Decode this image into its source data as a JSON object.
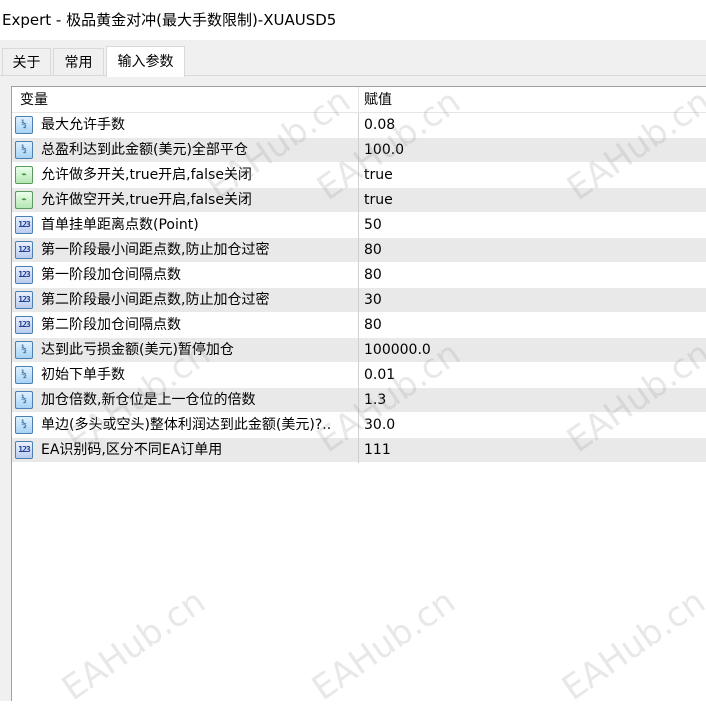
{
  "window": {
    "title": "Expert - 极品黄金对冲(最大手数限制)-XUAUSD5"
  },
  "tabs": [
    {
      "label": "关于"
    },
    {
      "label": "常用"
    },
    {
      "label": "输入参数"
    }
  ],
  "grid": {
    "col_variable": "变量",
    "col_value": "赋值",
    "rows": [
      {
        "icon": "double-type-icon",
        "name": "最大允许手数",
        "value": "0.08"
      },
      {
        "icon": "double-type-icon",
        "name": "总盈利达到此金额(美元)全部平仓",
        "value": "100.0"
      },
      {
        "icon": "bool-type-icon",
        "name": "允许做多开关,true开启,false关闭",
        "value": "true"
      },
      {
        "icon": "bool-type-icon",
        "name": "允许做空开关,true开启,false关闭",
        "value": "true"
      },
      {
        "icon": "int-type-icon",
        "name": "首单挂单距离点数(Point)",
        "value": "50"
      },
      {
        "icon": "int-type-icon",
        "name": "第一阶段最小间距点数,防止加仓过密",
        "value": "80"
      },
      {
        "icon": "int-type-icon",
        "name": "第一阶段加仓间隔点数",
        "value": "80"
      },
      {
        "icon": "int-type-icon",
        "name": "第二阶段最小间距点数,防止加仓过密",
        "value": "30"
      },
      {
        "icon": "int-type-icon",
        "name": "第二阶段加仓间隔点数",
        "value": "80"
      },
      {
        "icon": "double-type-icon",
        "name": "达到此亏损金额(美元)暂停加仓",
        "value": "100000.0"
      },
      {
        "icon": "double-type-icon",
        "name": "初始下单手数",
        "value": "0.01"
      },
      {
        "icon": "double-type-icon",
        "name": "加仓倍数,新仓位是上一仓位的倍数",
        "value": "1.3"
      },
      {
        "icon": "double-type-icon",
        "name": "单边(多头或空头)整体利润达到此金额(美元)?..",
        "value": "30.0"
      },
      {
        "icon": "int-type-icon",
        "name": "EA识别码,区分不同EA订单用",
        "value": "111"
      }
    ]
  },
  "watermark": {
    "text": "EAHub.cn"
  },
  "icon_glyphs": {
    "double": "½",
    "int": "123",
    "bool": "⌁"
  }
}
